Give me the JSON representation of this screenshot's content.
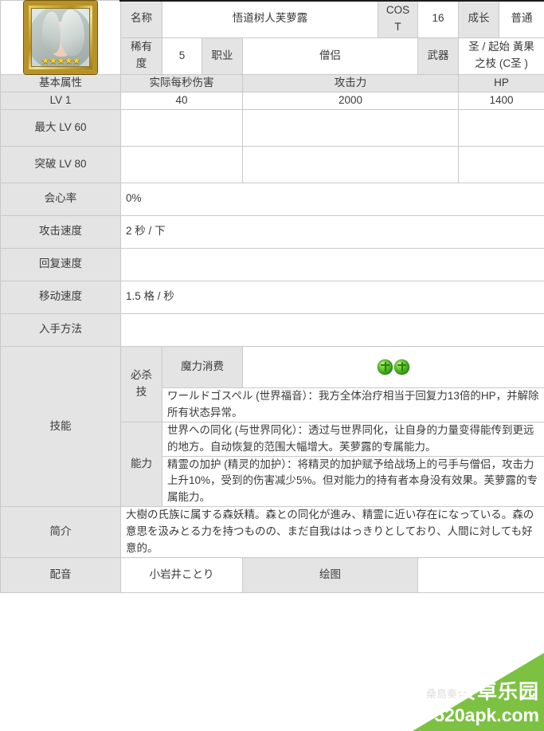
{
  "character": {
    "portrait": {
      "icon": "character-portrait-icon",
      "rarity_stars": "★★★★★"
    },
    "header": {
      "name_label": "名称",
      "name_value": "悟道树人芙萝露",
      "cost_label": "COST",
      "cost_value": "16",
      "growth_label": "成长",
      "growth_value": "普通",
      "rarity_label": "稀有度",
      "rarity_value": "5",
      "class_label": "职业",
      "class_value": "僧侣",
      "weapon_label": "武器",
      "weapon_value": "圣 / 起始 黃果之枝 (C圣 )"
    }
  },
  "stats": {
    "section_label": "基本属性",
    "columns": [
      "实际每秒伤害",
      "攻击力",
      "HP"
    ],
    "rows": [
      {
        "label": "LV 1",
        "values": [
          "40",
          "2000",
          "1400"
        ]
      },
      {
        "label": "最大 LV 60",
        "values": [
          "",
          "",
          ""
        ]
      },
      {
        "label": "突破 LV 80",
        "values": [
          "",
          "",
          ""
        ]
      }
    ],
    "single_rows": [
      {
        "label": "会心率",
        "value": "0%"
      },
      {
        "label": "攻击速度",
        "value": "2 秒 / 下"
      },
      {
        "label": "回复速度",
        "value": ""
      },
      {
        "label": "移动速度",
        "value": "1.5 格 / 秒"
      },
      {
        "label": "入手方法",
        "value": ""
      }
    ]
  },
  "skills": {
    "section_label": "技能",
    "special_label": "必杀技",
    "mana_label": "魔力消费",
    "mana_cost_orbs": 2,
    "special_description": "ワールドゴスペル (世界福音）：我方全体治疗相当于回复力13倍的HP，并解除所有状态异常。",
    "ability_label": "能力",
    "abilities": [
      "世界への同化 (与世界同化）：透过与世界同化，让自身的力量变得能传到更远的地方。自动恢复的范围大幅增大。芙萝露的专属能力。",
      "精霊の加护 (精灵的加护）：将精灵的加护赋予给战场上的弓手与僧侣，攻击力上升10%，受到的伤害减少5%。但对能力的持有者本身没有效果。芙萝露的专属能力。"
    ]
  },
  "profile": {
    "label": "简介",
    "text": "大樹の氏族に属する森妖精。森との同化が進み、精霊に近い存在になっている。森の意思を汲みとる力を持つものの、まだ自我ははっきりとしており、人間に対しても好意的。"
  },
  "credits": {
    "voice_label": "配音",
    "voice_value": "小岩井ことり",
    "art_label": "绘图",
    "art_value": ""
  },
  "watermark": {
    "line1": "安卓乐园",
    "line2": "520apk.com",
    "ghost": "桑島秦音",
    "color": "#7cc142"
  }
}
